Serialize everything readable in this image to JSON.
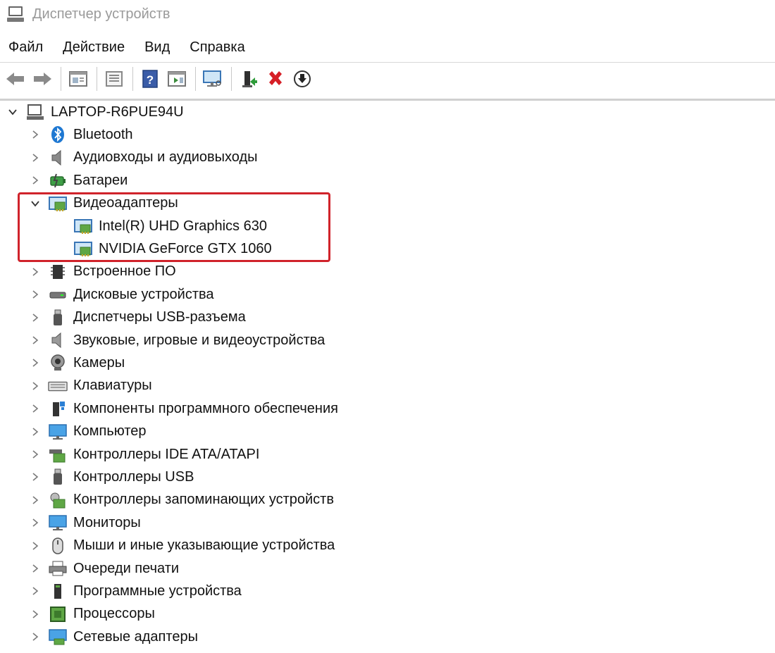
{
  "window": {
    "title": "Диспетчер устройств"
  },
  "menu": {
    "file": "Файл",
    "action": "Действие",
    "view": "Вид",
    "help": "Справка"
  },
  "toolbar": {
    "buttons": [
      "back-icon",
      "forward-icon",
      "properties-pane-icon",
      "list-icon",
      "help-icon",
      "show-icon",
      "monitor-scan-icon",
      "enable-device-icon",
      "remove-device-icon",
      "update-driver-icon"
    ]
  },
  "tree": {
    "root": "LAPTOP-R6PUE94U",
    "categories": [
      {
        "label": "Bluetooth",
        "icon": "bluetooth-icon",
        "expanded": false
      },
      {
        "label": "Аудиовходы и аудиовыходы",
        "icon": "speaker-icon",
        "expanded": false
      },
      {
        "label": "Батареи",
        "icon": "battery-icon",
        "expanded": false
      },
      {
        "label": "Видеоадаптеры",
        "icon": "display-adapter-icon",
        "expanded": true,
        "children": [
          "Intel(R) UHD Graphics 630",
          "NVIDIA GeForce GTX 1060"
        ]
      },
      {
        "label": "Встроенное ПО",
        "icon": "firmware-icon",
        "expanded": false
      },
      {
        "label": "Дисковые устройства",
        "icon": "disk-icon",
        "expanded": false
      },
      {
        "label": "Диспетчеры USB-разъема",
        "icon": "usb-icon",
        "expanded": false
      },
      {
        "label": "Звуковые, игровые и видеоустройства",
        "icon": "sound-icon",
        "expanded": false
      },
      {
        "label": "Камеры",
        "icon": "camera-icon",
        "expanded": false
      },
      {
        "label": "Клавиатуры",
        "icon": "keyboard-icon",
        "expanded": false
      },
      {
        "label": "Компоненты программного обеспечения",
        "icon": "software-component-icon",
        "expanded": false
      },
      {
        "label": "Компьютер",
        "icon": "computer-icon",
        "expanded": false
      },
      {
        "label": "Контроллеры IDE ATA/ATAPI",
        "icon": "ide-controller-icon",
        "expanded": false
      },
      {
        "label": "Контроллеры USB",
        "icon": "usb-controller-icon",
        "expanded": false
      },
      {
        "label": "Контроллеры запоминающих устройств",
        "icon": "storage-controller-icon",
        "expanded": false
      },
      {
        "label": "Мониторы",
        "icon": "monitor-icon",
        "expanded": false
      },
      {
        "label": "Мыши и иные указывающие устройства",
        "icon": "mouse-icon",
        "expanded": false
      },
      {
        "label": "Очереди печати",
        "icon": "printer-icon",
        "expanded": false
      },
      {
        "label": "Программные устройства",
        "icon": "software-device-icon",
        "expanded": false
      },
      {
        "label": "Процессоры",
        "icon": "processor-icon",
        "expanded": false
      },
      {
        "label": "Сетевые адаптеры",
        "icon": "network-adapter-icon",
        "expanded": false
      }
    ]
  },
  "colors": {
    "highlight": "#d0232b",
    "title_text": "#9a9a9a"
  }
}
